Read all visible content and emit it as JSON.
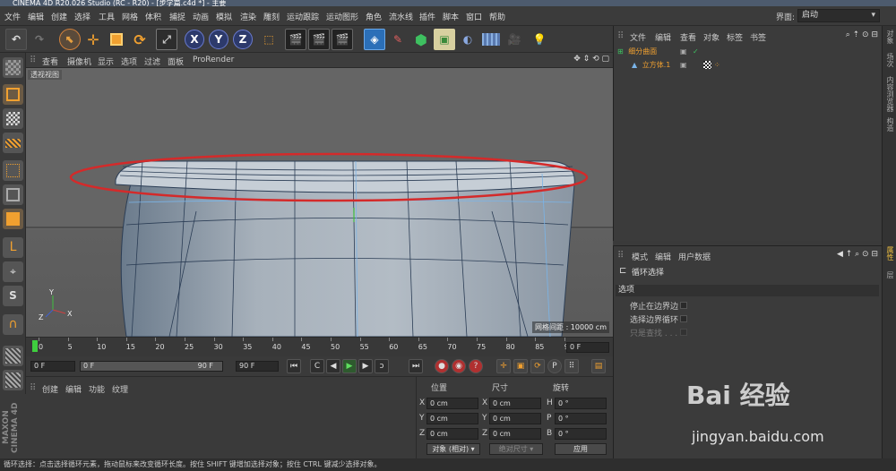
{
  "app": {
    "title": "CINEMA 4D R20.026 Studio (RC - R20) - [步学篇.c4d *] - 主要",
    "layout_label": "界面:",
    "layout_value": "启动"
  },
  "menu": [
    "文件",
    "编辑",
    "创建",
    "选择",
    "工具",
    "网格",
    "体积",
    "捕捉",
    "动画",
    "模拟",
    "渲染",
    "雕刻",
    "运动跟踪",
    "运动图形",
    "角色",
    "流水线",
    "插件",
    "脚本",
    "窗口",
    "帮助"
  ],
  "toolbar": {
    "x_label": "X",
    "y_label": "Y",
    "z_label": "Z"
  },
  "viewport": {
    "menu": [
      "查看",
      "摄像机",
      "显示",
      "选项",
      "过滤",
      "面板",
      "ProRender"
    ],
    "view_name": "透视视图",
    "grid_spacing": "网格间距 : 10000 cm",
    "axis_y": "Y",
    "axis_x": "X",
    "axis_z": "Z"
  },
  "timeline": {
    "ticks": [
      "0",
      "5",
      "10",
      "15",
      "20",
      "25",
      "30",
      "35",
      "40",
      "45",
      "50",
      "55",
      "60",
      "65",
      "70",
      "75",
      "80",
      "85",
      "90"
    ],
    "current_frame": "0 F",
    "start_frame": "0 F",
    "range_start": "0 F",
    "range_end": "90 F",
    "end_frame": "90 F"
  },
  "material_panel": {
    "menu": [
      "创建",
      "编辑",
      "功能",
      "纹理"
    ]
  },
  "coordinates": {
    "headers": [
      "位置",
      "尺寸",
      "旋转"
    ],
    "rows": [
      {
        "axis": "X",
        "pos": "0 cm",
        "size_axis": "X",
        "size": "0 cm",
        "rot_axis": "H",
        "rot": "0 °"
      },
      {
        "axis": "Y",
        "pos": "0 cm",
        "size_axis": "Y",
        "size": "0 cm",
        "rot_axis": "P",
        "rot": "0 °"
      },
      {
        "axis": "Z",
        "pos": "0 cm",
        "size_axis": "Z",
        "size": "0 cm",
        "rot_axis": "B",
        "rot": "0 °"
      }
    ],
    "mode": "对象 (相对)",
    "size_mode": "绝对尺寸",
    "apply": "应用"
  },
  "objects": {
    "menu": [
      "文件",
      "编辑",
      "查看",
      "对象",
      "标签",
      "书签"
    ],
    "items": [
      {
        "name": "细分曲面",
        "color": "#f0a030"
      },
      {
        "name": "立方体.1",
        "color": "#f0a030"
      }
    ]
  },
  "attributes": {
    "menu": [
      "模式",
      "编辑",
      "用户数据"
    ],
    "tool_name": "循环选择",
    "section": "选项",
    "options": [
      "停止在边界边",
      "选择边界循环",
      "只是查找 . . ."
    ]
  },
  "right_tabs": [
    "对象",
    "场次",
    "内容浏览器",
    "构造"
  ],
  "right_tabs_lower": [
    "属性",
    "层"
  ],
  "status": "循环选择：点击选择循环元素，拖动鼠标来改变循环长度。按住 SHIFT 键增加选择对象；按住 CTRL 键减少选择对象。",
  "watermark": {
    "brand": "Bai 经验",
    "url": "jingyan.baidu.com"
  },
  "maxon": "MAXON CINEMA 4D"
}
